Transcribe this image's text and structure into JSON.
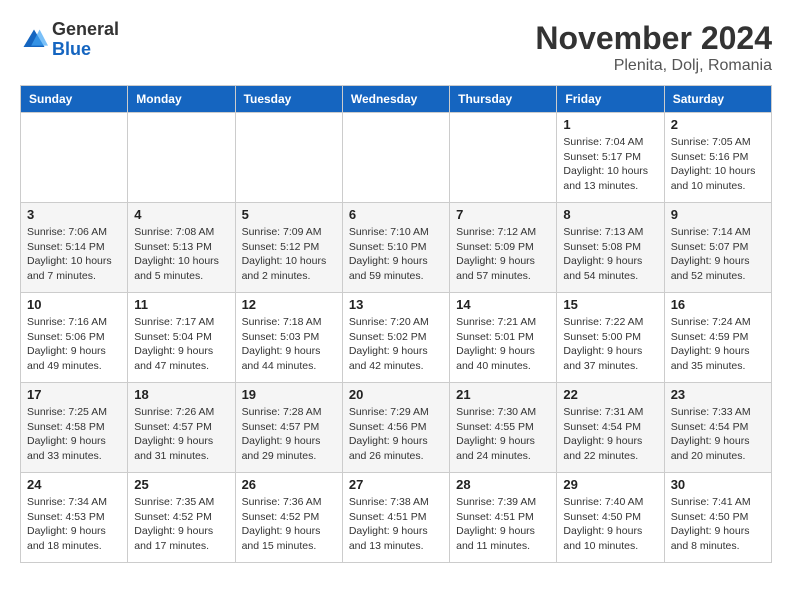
{
  "header": {
    "logo_general": "General",
    "logo_blue": "Blue",
    "month_title": "November 2024",
    "location": "Plenita, Dolj, Romania"
  },
  "days_of_week": [
    "Sunday",
    "Monday",
    "Tuesday",
    "Wednesday",
    "Thursday",
    "Friday",
    "Saturday"
  ],
  "weeks": [
    [
      {
        "day": "",
        "info": ""
      },
      {
        "day": "",
        "info": ""
      },
      {
        "day": "",
        "info": ""
      },
      {
        "day": "",
        "info": ""
      },
      {
        "day": "",
        "info": ""
      },
      {
        "day": "1",
        "info": "Sunrise: 7:04 AM\nSunset: 5:17 PM\nDaylight: 10 hours and 13 minutes."
      },
      {
        "day": "2",
        "info": "Sunrise: 7:05 AM\nSunset: 5:16 PM\nDaylight: 10 hours and 10 minutes."
      }
    ],
    [
      {
        "day": "3",
        "info": "Sunrise: 7:06 AM\nSunset: 5:14 PM\nDaylight: 10 hours and 7 minutes."
      },
      {
        "day": "4",
        "info": "Sunrise: 7:08 AM\nSunset: 5:13 PM\nDaylight: 10 hours and 5 minutes."
      },
      {
        "day": "5",
        "info": "Sunrise: 7:09 AM\nSunset: 5:12 PM\nDaylight: 10 hours and 2 minutes."
      },
      {
        "day": "6",
        "info": "Sunrise: 7:10 AM\nSunset: 5:10 PM\nDaylight: 9 hours and 59 minutes."
      },
      {
        "day": "7",
        "info": "Sunrise: 7:12 AM\nSunset: 5:09 PM\nDaylight: 9 hours and 57 minutes."
      },
      {
        "day": "8",
        "info": "Sunrise: 7:13 AM\nSunset: 5:08 PM\nDaylight: 9 hours and 54 minutes."
      },
      {
        "day": "9",
        "info": "Sunrise: 7:14 AM\nSunset: 5:07 PM\nDaylight: 9 hours and 52 minutes."
      }
    ],
    [
      {
        "day": "10",
        "info": "Sunrise: 7:16 AM\nSunset: 5:06 PM\nDaylight: 9 hours and 49 minutes."
      },
      {
        "day": "11",
        "info": "Sunrise: 7:17 AM\nSunset: 5:04 PM\nDaylight: 9 hours and 47 minutes."
      },
      {
        "day": "12",
        "info": "Sunrise: 7:18 AM\nSunset: 5:03 PM\nDaylight: 9 hours and 44 minutes."
      },
      {
        "day": "13",
        "info": "Sunrise: 7:20 AM\nSunset: 5:02 PM\nDaylight: 9 hours and 42 minutes."
      },
      {
        "day": "14",
        "info": "Sunrise: 7:21 AM\nSunset: 5:01 PM\nDaylight: 9 hours and 40 minutes."
      },
      {
        "day": "15",
        "info": "Sunrise: 7:22 AM\nSunset: 5:00 PM\nDaylight: 9 hours and 37 minutes."
      },
      {
        "day": "16",
        "info": "Sunrise: 7:24 AM\nSunset: 4:59 PM\nDaylight: 9 hours and 35 minutes."
      }
    ],
    [
      {
        "day": "17",
        "info": "Sunrise: 7:25 AM\nSunset: 4:58 PM\nDaylight: 9 hours and 33 minutes."
      },
      {
        "day": "18",
        "info": "Sunrise: 7:26 AM\nSunset: 4:57 PM\nDaylight: 9 hours and 31 minutes."
      },
      {
        "day": "19",
        "info": "Sunrise: 7:28 AM\nSunset: 4:57 PM\nDaylight: 9 hours and 29 minutes."
      },
      {
        "day": "20",
        "info": "Sunrise: 7:29 AM\nSunset: 4:56 PM\nDaylight: 9 hours and 26 minutes."
      },
      {
        "day": "21",
        "info": "Sunrise: 7:30 AM\nSunset: 4:55 PM\nDaylight: 9 hours and 24 minutes."
      },
      {
        "day": "22",
        "info": "Sunrise: 7:31 AM\nSunset: 4:54 PM\nDaylight: 9 hours and 22 minutes."
      },
      {
        "day": "23",
        "info": "Sunrise: 7:33 AM\nSunset: 4:54 PM\nDaylight: 9 hours and 20 minutes."
      }
    ],
    [
      {
        "day": "24",
        "info": "Sunrise: 7:34 AM\nSunset: 4:53 PM\nDaylight: 9 hours and 18 minutes."
      },
      {
        "day": "25",
        "info": "Sunrise: 7:35 AM\nSunset: 4:52 PM\nDaylight: 9 hours and 17 minutes."
      },
      {
        "day": "26",
        "info": "Sunrise: 7:36 AM\nSunset: 4:52 PM\nDaylight: 9 hours and 15 minutes."
      },
      {
        "day": "27",
        "info": "Sunrise: 7:38 AM\nSunset: 4:51 PM\nDaylight: 9 hours and 13 minutes."
      },
      {
        "day": "28",
        "info": "Sunrise: 7:39 AM\nSunset: 4:51 PM\nDaylight: 9 hours and 11 minutes."
      },
      {
        "day": "29",
        "info": "Sunrise: 7:40 AM\nSunset: 4:50 PM\nDaylight: 9 hours and 10 minutes."
      },
      {
        "day": "30",
        "info": "Sunrise: 7:41 AM\nSunset: 4:50 PM\nDaylight: 9 hours and 8 minutes."
      }
    ]
  ]
}
